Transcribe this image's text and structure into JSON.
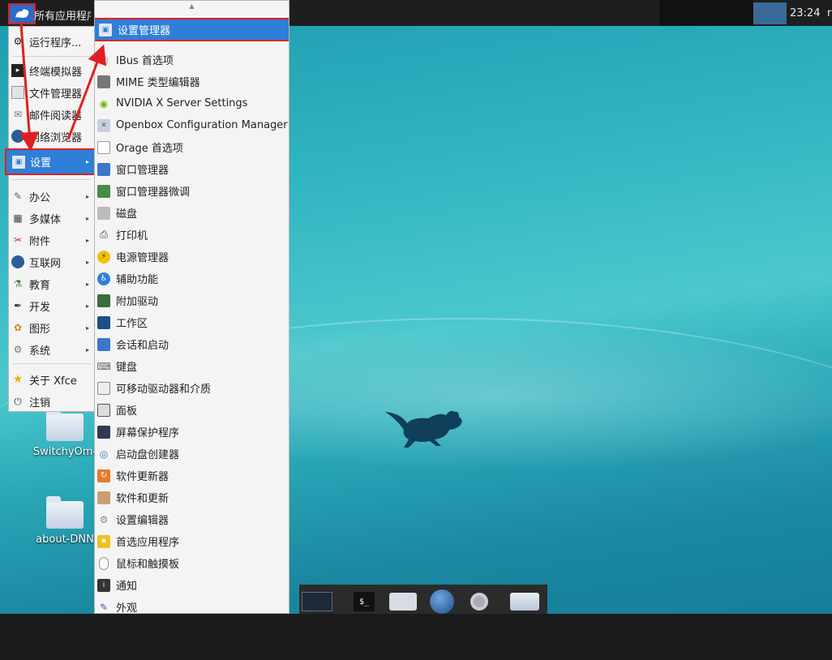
{
  "top_panel": {
    "apps_label": "所有应用程序",
    "clock": "23:24",
    "clock_extra": "r"
  },
  "desktop_icons": [
    {
      "label": "SwitchyOm-"
    },
    {
      "label": "about-DNN"
    }
  ],
  "main_menu": {
    "items": [
      {
        "label": "运行程序...",
        "icon": "run-icon"
      },
      {
        "label": "终端模拟器",
        "icon": "terminal-icon"
      },
      {
        "label": "文件管理器",
        "icon": "folder-icon"
      },
      {
        "label": "邮件阅读器",
        "icon": "mail-icon"
      },
      {
        "label": "网络浏览器",
        "icon": "browser-icon"
      },
      {
        "label": "设置",
        "icon": "settings-icon"
      },
      {
        "label": "办公",
        "icon": "office-icon"
      },
      {
        "label": "多媒体",
        "icon": "multimedia-icon"
      },
      {
        "label": "附件",
        "icon": "accessories-icon"
      },
      {
        "label": "互联网",
        "icon": "internet-icon"
      },
      {
        "label": "教育",
        "icon": "education-icon"
      },
      {
        "label": "开发",
        "icon": "development-icon"
      },
      {
        "label": "图形",
        "icon": "graphics-icon"
      },
      {
        "label": "系统",
        "icon": "system-icon"
      },
      {
        "label": "关于 Xfce",
        "icon": "star-icon"
      },
      {
        "label": "注销",
        "icon": "power-icon"
      }
    ]
  },
  "sub_menu": {
    "items": [
      {
        "label": "设置管理器"
      },
      {
        "label": "IBus 首选项"
      },
      {
        "label": "MIME 类型编辑器"
      },
      {
        "label": "NVIDIA X Server Settings"
      },
      {
        "label": "Openbox Configuration Manager"
      },
      {
        "label": "Orage 首选项"
      },
      {
        "label": "窗口管理器"
      },
      {
        "label": "窗口管理器微调"
      },
      {
        "label": "磁盘"
      },
      {
        "label": "打印机"
      },
      {
        "label": "电源管理器"
      },
      {
        "label": "辅助功能"
      },
      {
        "label": "附加驱动"
      },
      {
        "label": "工作区"
      },
      {
        "label": "会话和启动"
      },
      {
        "label": "键盘"
      },
      {
        "label": "可移动驱动器和介质"
      },
      {
        "label": "面板"
      },
      {
        "label": "屏幕保护程序"
      },
      {
        "label": "启动盘创建器"
      },
      {
        "label": "软件更新器"
      },
      {
        "label": "软件和更新"
      },
      {
        "label": "设置编辑器"
      },
      {
        "label": "首选应用程序"
      },
      {
        "label": "鼠标和触摸板"
      },
      {
        "label": "通知"
      },
      {
        "label": "外观"
      }
    ]
  },
  "dock": {
    "icons": [
      "desktop-icon",
      "terminal-icon",
      "home-folder-icon",
      "browser-icon",
      "search-icon",
      "folder-icon"
    ]
  },
  "colors": {
    "highlight": "#2e7fd8",
    "annotation_red": "#e02020"
  }
}
